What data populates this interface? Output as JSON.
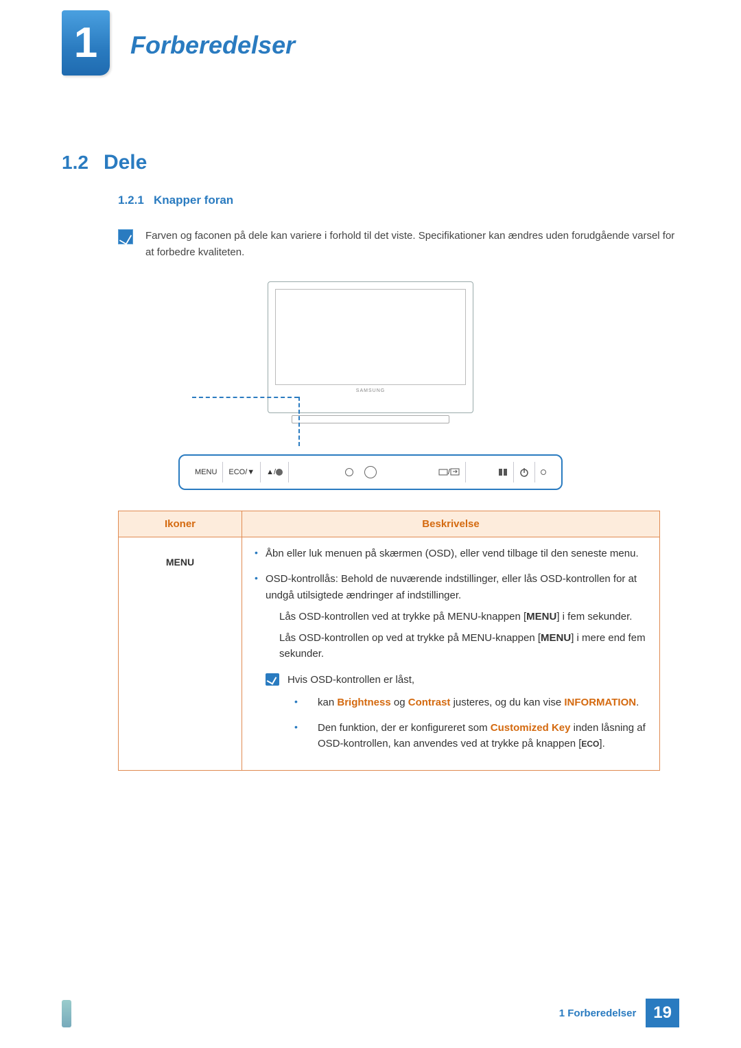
{
  "chapter": {
    "number": "1",
    "title": "Forberedelser"
  },
  "section": {
    "number": "1.2",
    "title": "Dele"
  },
  "subsection": {
    "number": "1.2.1",
    "title": "Knapper foran"
  },
  "note_top": "Farven og faconen på dele kan variere i forhold til det viste. Specifikationer kan ændres uden forudgående varsel for at forbedre kvaliteten.",
  "diagram": {
    "brand": "SAMSUNG",
    "buttons": {
      "menu": "MENU",
      "eco": "ECO/▼",
      "up": "▲/",
      "source": "/"
    }
  },
  "table": {
    "headers": {
      "icons": "Ikoner",
      "desc": "Beskrivelse"
    },
    "row1": {
      "icon": "MENU",
      "b1": "Åbn eller luk menuen på skærmen (OSD), eller vend tilbage til den seneste menu.",
      "b2": "OSD-kontrollås: Behold de nuværende indstillinger, eller lås OSD-kontrollen for at undgå utilsigtede ændringer af indstillinger.",
      "p1a": "Lås OSD-kontrollen ved at trykke på MENU-knappen [",
      "p1b": "] i fem sekunder.",
      "p2a": "Lås OSD-kontrollen op ved at trykke på MENU-knappen [",
      "p2b": "] i mere end fem sekunder.",
      "menu_inline": "MENU",
      "note": {
        "intro": "Hvis OSD-kontrollen er låst,",
        "li1a": "kan ",
        "li1_brightness": "Brightness",
        "li1b": " og ",
        "li1_contrast": "Contrast",
        "li1c": " justeres, og du kan vise ",
        "li1_info": "INFORMATION",
        "li1d": ".",
        "li2a": "Den funktion, der er konfigureret som ",
        "li2_custom": "Customized Key",
        "li2b": " inden låsning af OSD-kontrollen, kan anvendes ved at trykke på knappen [",
        "li2_eco": "ECO",
        "li2c": "]."
      }
    }
  },
  "footer": {
    "chapter_label": "1 Forberedelser",
    "page": "19"
  }
}
